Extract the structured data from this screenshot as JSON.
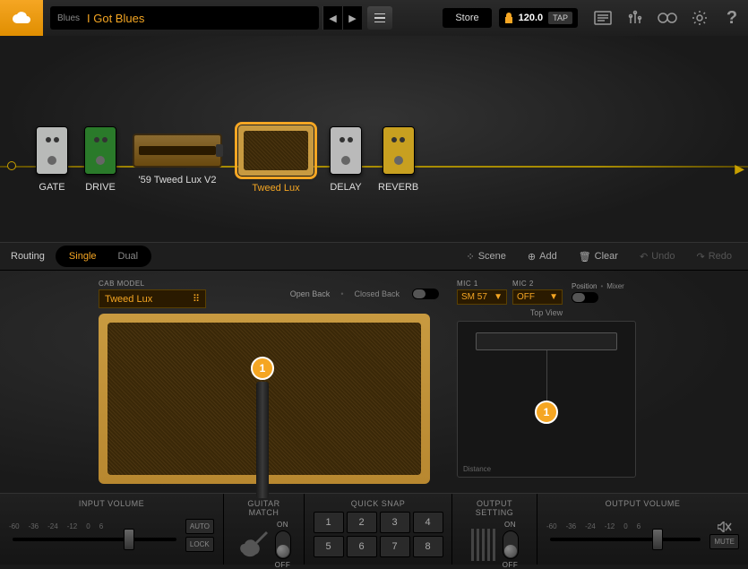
{
  "header": {
    "category": "Blues",
    "preset": "I Got Blues",
    "store": "Store",
    "tempo": "120.0",
    "tap": "TAP"
  },
  "chain": [
    {
      "id": "gate",
      "label": "GATE",
      "kind": "pedal",
      "color": "#b8bab8"
    },
    {
      "id": "drive",
      "label": "DRIVE",
      "kind": "pedal",
      "color": "#2a7a2a"
    },
    {
      "id": "amp",
      "label": "'59 Tweed Lux V2",
      "kind": "amp"
    },
    {
      "id": "cab",
      "label": "Tweed Lux",
      "kind": "cab",
      "selected": true
    },
    {
      "id": "delay",
      "label": "DELAY",
      "kind": "pedal",
      "color": "#bababa"
    },
    {
      "id": "reverb",
      "label": "REVERB",
      "kind": "pedal",
      "color": "#c8a020"
    }
  ],
  "routing": {
    "label": "Routing",
    "single": "Single",
    "dual": "Dual",
    "active": "single",
    "scene": "Scene",
    "add": "Add",
    "clear": "Clear",
    "undo": "Undo",
    "redo": "Redo"
  },
  "cab": {
    "cab_model_label": "CAB MODEL",
    "model": "Tweed Lux",
    "open_back": "Open Back",
    "closed_back": "Closed Back",
    "mic1_label": "MIC 1",
    "mic1": "SM 57",
    "mic2_label": "MIC 2",
    "mic2": "OFF",
    "position_label": "Position",
    "mixer_label": "Mixer",
    "top_view": "Top View",
    "distance": "Distance",
    "marker": "1"
  },
  "footer": {
    "input": "INPUT VOLUME",
    "guitar_match": "GUITAR MATCH",
    "quick_snap": "QUICK SNAP",
    "output_setting": "OUTPUT SETTING",
    "output": "OUTPUT VOLUME",
    "auto": "AUTO",
    "lock": "LOCK",
    "on": "ON",
    "off": "OFF",
    "mute": "MUTE",
    "ticks": [
      "-60",
      "-36",
      "-24",
      "-12",
      "0",
      "6"
    ],
    "snaps": [
      "1",
      "2",
      "3",
      "4",
      "5",
      "6",
      "7",
      "8"
    ]
  }
}
